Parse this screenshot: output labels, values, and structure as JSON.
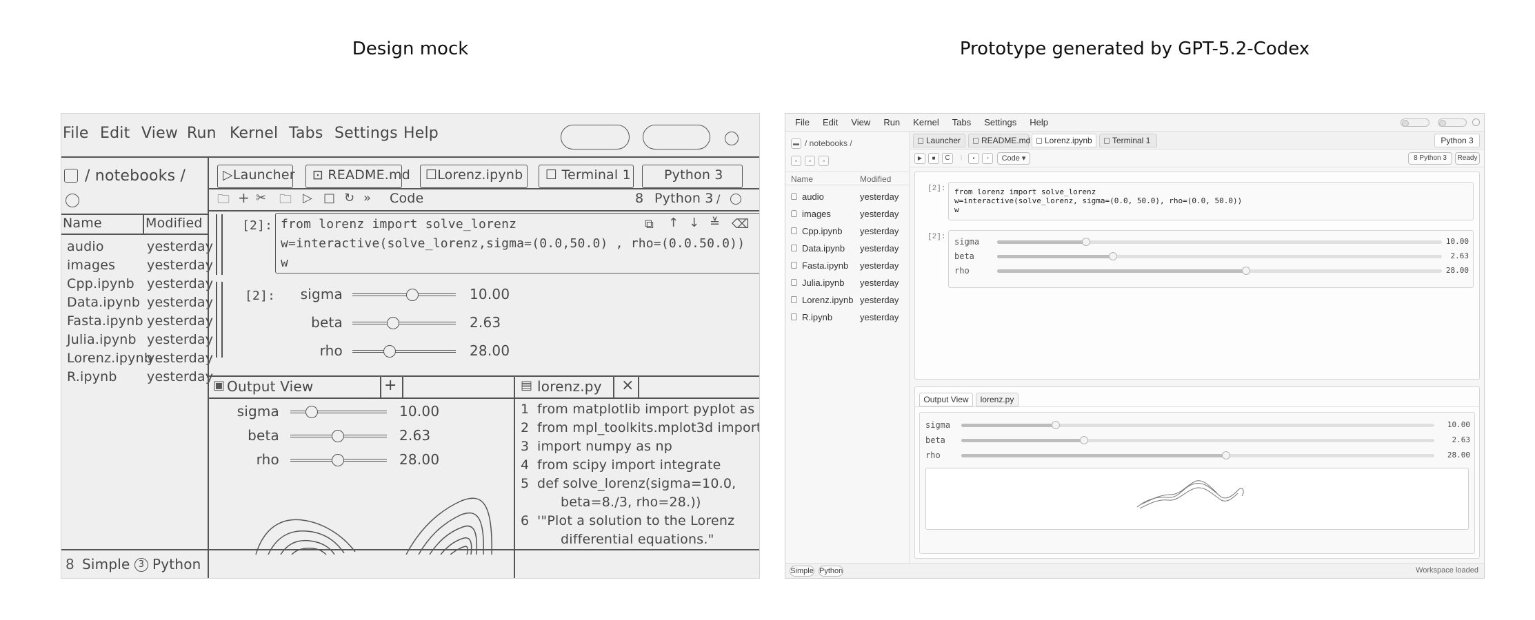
{
  "captions": {
    "left": "Design mock",
    "right": "Prototype generated by GPT-5.2-Codex"
  },
  "mock": {
    "menu": [
      "File",
      "Edit",
      "View",
      "Run",
      "Kernel",
      "Tabs",
      "Settings",
      "Help"
    ],
    "breadcrumb": "/ notebooks /",
    "file_headers": {
      "name": "Name",
      "modified": "Modified"
    },
    "files": [
      {
        "name": "audio",
        "modified": "yesterday"
      },
      {
        "name": "images",
        "modified": "yesterday"
      },
      {
        "name": "Cpp.ipynb",
        "modified": "yesterday"
      },
      {
        "name": "Data.ipynb",
        "modified": "yesterday"
      },
      {
        "name": "Fasta.ipynb",
        "modified": "yesterday"
      },
      {
        "name": "Julia.ipynb",
        "modified": "yesterday"
      },
      {
        "name": "Lorenz.ipynb",
        "modified": "yesterday"
      },
      {
        "name": "R.ipynb",
        "modified": "yesterday"
      }
    ],
    "tabs": [
      "Launcher",
      "README.md",
      "Lorenz.ipynb",
      "Terminal 1"
    ],
    "kernel_tab": "Python 3",
    "toolbar_mode": "Code",
    "toolbar_kernel": "Python 3",
    "toolbar_kernel_prefix": "8",
    "cell_prompt": "[2]:",
    "code_lines": [
      "from lorenz import solve_lorenz",
      "w=interactive(solve_lorenz,sigma=(0.0,50.0) , rho=(0.0.50.0))",
      "w"
    ],
    "output_prompt": "[2]:",
    "sliders": [
      {
        "label": "sigma",
        "value": "10.00",
        "fraction": 0.58
      },
      {
        "label": "beta",
        "value": "2.63",
        "fraction": 0.39
      },
      {
        "label": "rho",
        "value": "28.00",
        "fraction": 0.36
      }
    ],
    "output_view_title": "Output View",
    "output_view_add": "+",
    "output_sliders": [
      {
        "label": "sigma",
        "value": "10.00",
        "fraction": 0.22
      },
      {
        "label": "beta",
        "value": "2.63",
        "fraction": 0.49
      },
      {
        "label": "rho",
        "value": "28.00",
        "fraction": 0.49
      }
    ],
    "editor_title": "lorenz.py",
    "editor_close": "×",
    "editor_lines": [
      {
        "n": "1",
        "text": "from matplotlib import pyplot as"
      },
      {
        "n": "2",
        "text": "from mpl_toolkits.mplot3d import"
      },
      {
        "n": "3",
        "text": "import numpy as np"
      },
      {
        "n": "4",
        "text": "from scipy import integrate"
      },
      {
        "n": "5",
        "text": "def solve_lorenz(sigma=10.0,"
      },
      {
        "n": "",
        "text": "beta=8./3, rho=28.))"
      },
      {
        "n": "6",
        "text": "'\"Plot a solution to the Lorenz"
      },
      {
        "n": "",
        "text": "differential equations.\""
      }
    ],
    "status": {
      "simple": "Simple",
      "python_badge": "3",
      "python": "Python"
    }
  },
  "prototype": {
    "menu": [
      "File",
      "Edit",
      "View",
      "Run",
      "Kernel",
      "Tabs",
      "Settings",
      "Help"
    ],
    "breadcrumb": "/ notebooks /",
    "file_headers": {
      "name": "Name",
      "modified": "Modified"
    },
    "files": [
      {
        "name": "audio",
        "modified": "yesterday"
      },
      {
        "name": "images",
        "modified": "yesterday"
      },
      {
        "name": "Cpp.ipynb",
        "modified": "yesterday"
      },
      {
        "name": "Data.ipynb",
        "modified": "yesterday"
      },
      {
        "name": "Fasta.ipynb",
        "modified": "yesterday"
      },
      {
        "name": "Julia.ipynb",
        "modified": "yesterday"
      },
      {
        "name": "Lorenz.ipynb",
        "modified": "yesterday"
      },
      {
        "name": "R.ipynb",
        "modified": "yesterday"
      }
    ],
    "tabs": [
      "Launcher",
      "README.md",
      "Lorenz.ipynb",
      "Terminal 1"
    ],
    "active_tab": "Lorenz.ipynb",
    "kernel_tab": "Python 3",
    "toolbar": {
      "mode": "Code",
      "kernel_status": "8 Python 3",
      "ready": "Ready"
    },
    "cell_prompt": "[2]:",
    "code": "from lorenz import solve_lorenz\nw=interactive(solve_lorenz, sigma=(0.0, 50.0), rho=(0.0, 50.0))\nw",
    "output_prompt": "[2]:",
    "sliders": [
      {
        "label": "sigma",
        "value": "10.00",
        "fraction": 0.2
      },
      {
        "label": "beta",
        "value": "2.63",
        "fraction": 0.26
      },
      {
        "label": "rho",
        "value": "28.00",
        "fraction": 0.56
      }
    ],
    "lower_tabs": [
      "Output View",
      "lorenz.py"
    ],
    "output_sliders": [
      {
        "label": "sigma",
        "value": "10.00",
        "fraction": 0.2
      },
      {
        "label": "beta",
        "value": "2.63",
        "fraction": 0.26
      },
      {
        "label": "rho",
        "value": "28.00",
        "fraction": 0.56
      }
    ],
    "status": {
      "simple": "Simple",
      "python": "Python",
      "right": "Workspace loaded"
    }
  }
}
